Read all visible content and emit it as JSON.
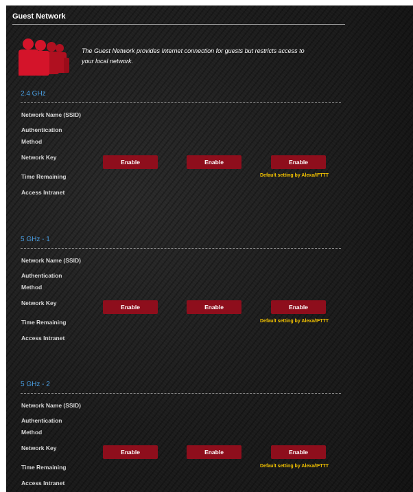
{
  "page": {
    "title": "Guest Network",
    "description_line1": "The Guest Network provides Internet connection for guests but restricts access to",
    "description_line2": "your local network."
  },
  "labels": {
    "ssid": "Network Name (SSID)",
    "auth1": "Authentication",
    "auth2": "Method",
    "key": "Network Key",
    "time": "Time Remaining",
    "intranet": "Access Intranet"
  },
  "button_label": "Enable",
  "default_note": "Default setting by Alexa/IFTTT",
  "bands": [
    {
      "title": "2.4 GHz"
    },
    {
      "title": "5 GHz - 1"
    },
    {
      "title": "5 GHz - 2"
    }
  ],
  "colors": {
    "accent_blue": "#4a9fe3",
    "button_red": "#8e0e1c",
    "note_yellow": "#f2c200"
  },
  "icons": {
    "guest": "guest-users-icon"
  }
}
